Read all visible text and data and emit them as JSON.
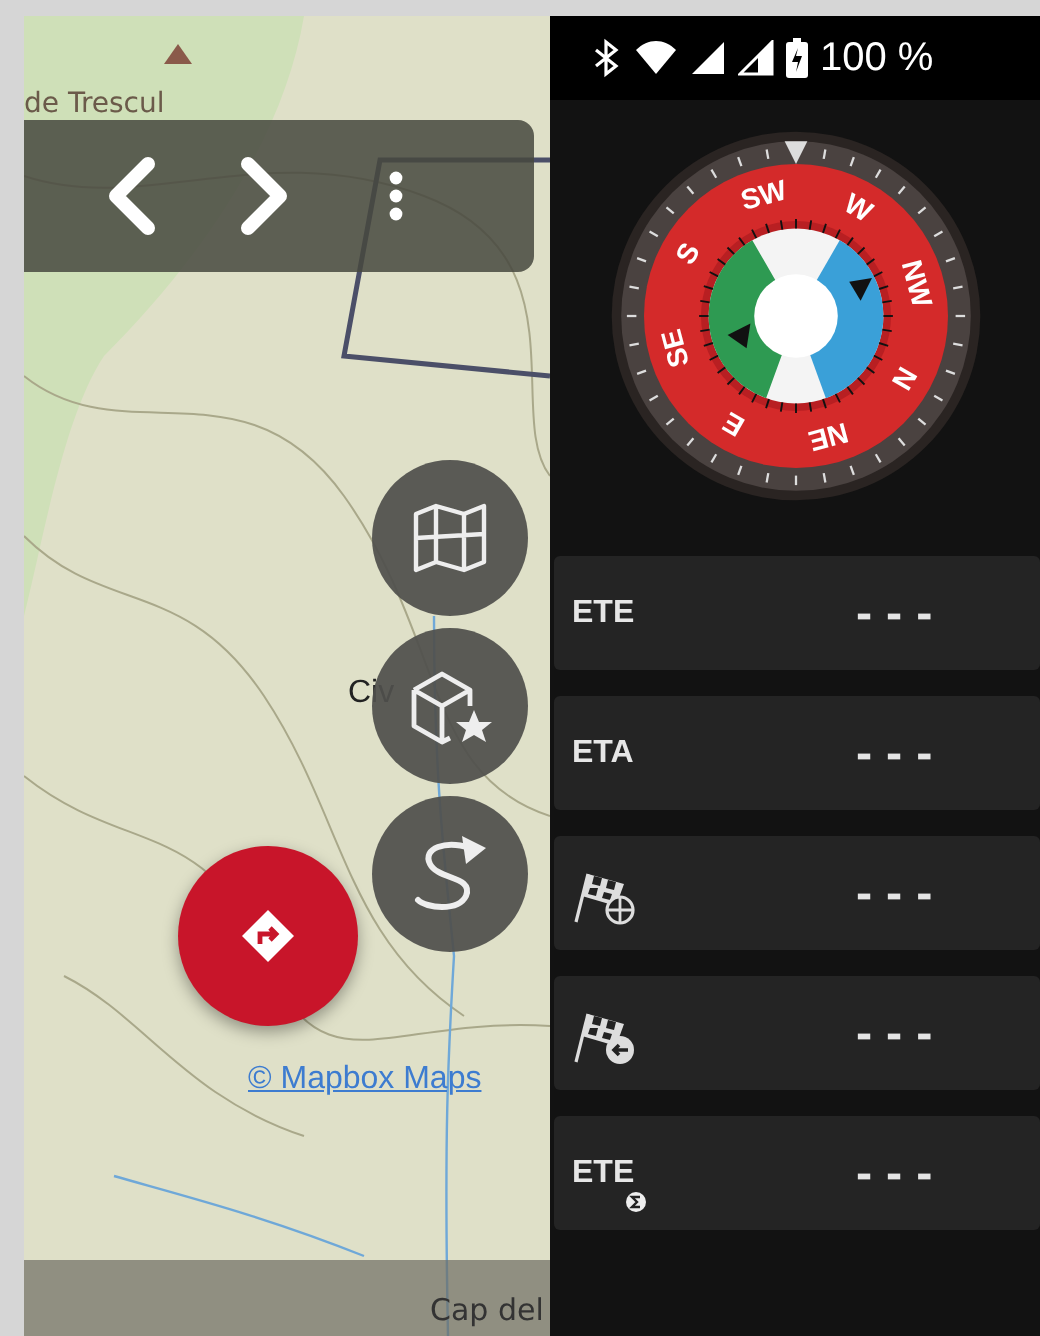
{
  "map": {
    "place_labels": [
      "de Trescul",
      "Civ"
    ],
    "attribution": "© Mapbox Maps",
    "bottom_label": "Cap del"
  },
  "status_bar": {
    "battery": "100 %"
  },
  "compass": {
    "labels": [
      "N",
      "NE",
      "E",
      "SE",
      "S",
      "SW",
      "W",
      "NW"
    ]
  },
  "stats": [
    {
      "kind": "label",
      "label": "ETE",
      "value": "---"
    },
    {
      "kind": "label",
      "label": "ETA",
      "value": "---"
    },
    {
      "kind": "flag_target",
      "value": "---"
    },
    {
      "kind": "flag_back",
      "value": "---"
    },
    {
      "kind": "label_total",
      "label": "ETE",
      "value": "---"
    }
  ]
}
